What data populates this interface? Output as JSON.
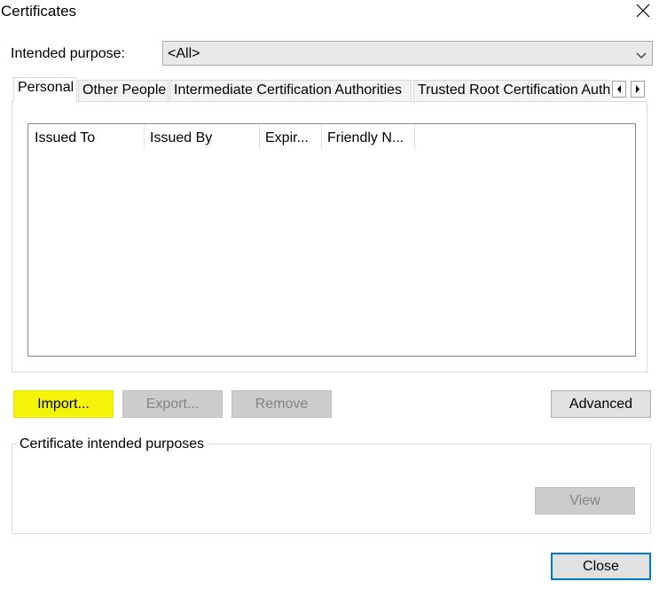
{
  "window": {
    "title": "Certificates"
  },
  "purpose": {
    "label": "Intended purpose:",
    "value": "<All>"
  },
  "tabs": [
    {
      "label": "Personal",
      "active": true
    },
    {
      "label": "Other People"
    },
    {
      "label": "Intermediate Certification Authorities"
    },
    {
      "label": "Trusted Root Certification Auth"
    }
  ],
  "list": {
    "columns": [
      "Issued To",
      "Issued By",
      "Expir...",
      "Friendly N..."
    ]
  },
  "buttons": {
    "import": "Import...",
    "export": "Export...",
    "remove": "Remove",
    "advanced": "Advanced",
    "view": "View",
    "close": "Close"
  },
  "group": {
    "label": "Certificate intended purposes"
  },
  "colors": {
    "highlight": "#f4f40a",
    "default_border": "#0078d7"
  },
  "icons": [
    "close-icon",
    "chevron-down-icon",
    "chevron-left-icon",
    "chevron-right-icon"
  ]
}
